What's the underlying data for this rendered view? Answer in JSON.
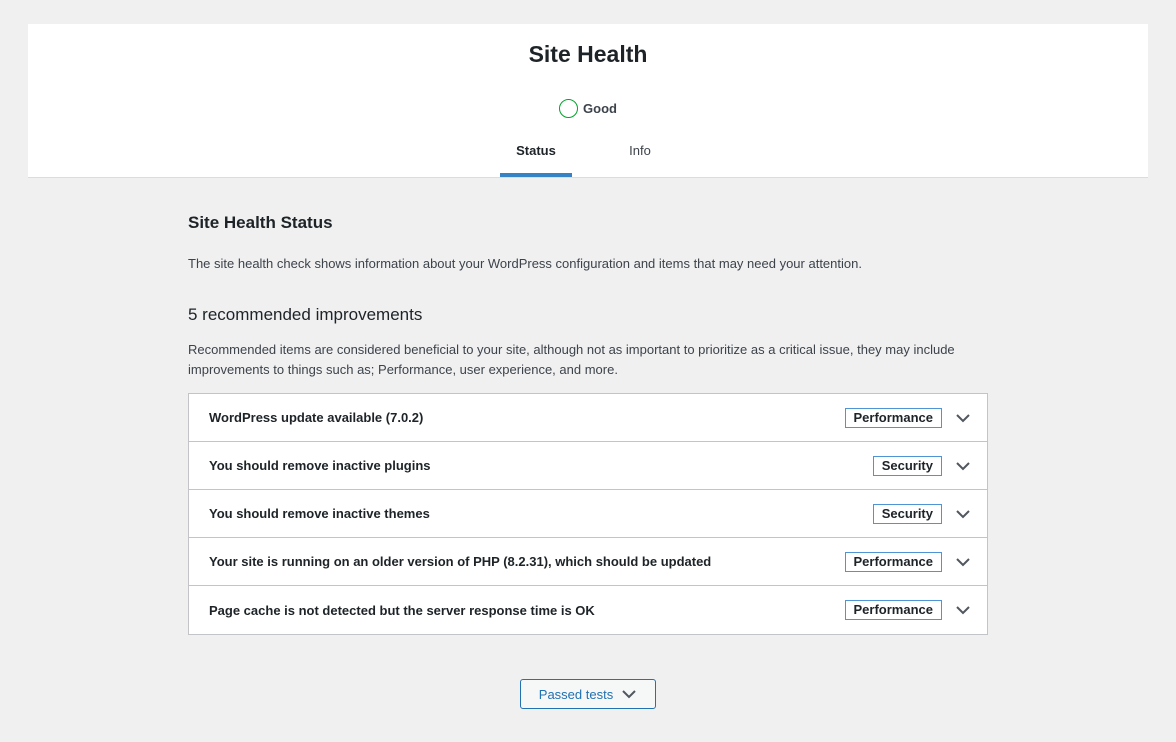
{
  "header": {
    "title": "Site Health",
    "status": {
      "label": "Good",
      "color": "#00a32a"
    },
    "tabs": [
      {
        "label": "Status",
        "active": true
      },
      {
        "label": "Info",
        "active": false
      }
    ]
  },
  "main": {
    "section_title": "Site Health Status",
    "description": "The site health check shows information about your WordPress configuration and items that may need your attention.",
    "recommended_title": "5 recommended improvements",
    "recommended_description": "Recommended items are considered beneficial to your site, although not as important to prioritize as a critical issue, they may include improvements to things such as; Performance, user experience, and more.",
    "items": [
      {
        "title": "WordPress update available (7.0.2)",
        "badge": "Performance"
      },
      {
        "title": "You should remove inactive plugins",
        "badge": "Security"
      },
      {
        "title": "You should remove inactive themes",
        "badge": "Security"
      },
      {
        "title": "Your site is running on an older version of PHP (8.2.31), which should be updated",
        "badge": "Performance"
      },
      {
        "title": "Page cache is not detected but the server response time is OK",
        "badge": "Performance"
      }
    ],
    "passed_tests_label": "Passed tests"
  },
  "colors": {
    "accent": "#2271b1",
    "tab_underline": "#3582c4",
    "badge_border": "#4f94d4"
  }
}
